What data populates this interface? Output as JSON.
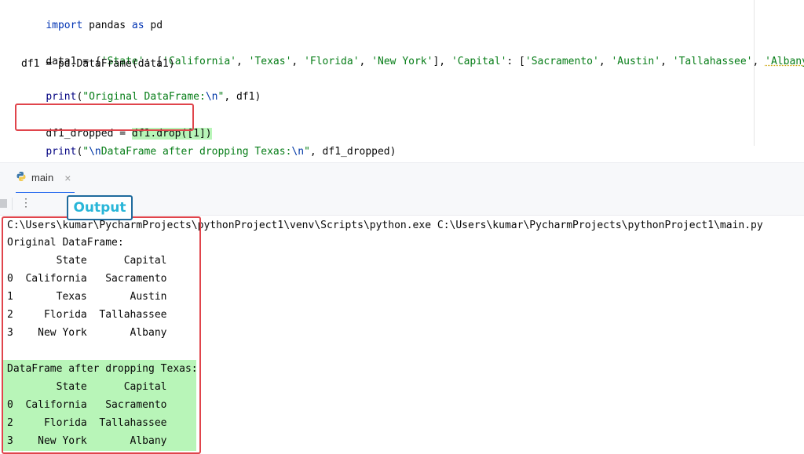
{
  "editor": {
    "line1": {
      "kw1": "import",
      "mod": " pandas ",
      "kw2": "as",
      "alias": " pd"
    },
    "line2": {
      "prefix": "data1 = {",
      "s1": "'State'",
      "p1": ": [",
      "s2": "'California'",
      "c1": ", ",
      "s3": "'Texas'",
      "c2": ", ",
      "s4": "'Florida'",
      "c3": ", ",
      "s5": "'New York'",
      "p2": "], ",
      "s6": "'Capital'",
      "p3": ": [",
      "s7": "'Sacramento'",
      "c4": ", ",
      "s8": "'Austin'",
      "c5": ", ",
      "s9": "'Tallahassee'",
      "c6": ", ",
      "s10": "'Albany'",
      "suffix": "]}"
    },
    "line3": "df1 = pd.DataFrame(data1)",
    "line4": {
      "fn": "print",
      "open": "(",
      "str_a": "\"Original DataFrame:",
      "esc": "\\n",
      "str_b": "\"",
      "rest": ", df1)"
    },
    "line5": {
      "lhs": "df1_dropped = ",
      "call": "df1.drop([1])"
    },
    "line6": {
      "fn": "print",
      "open": "(",
      "str_a": "\"",
      "esc1": "\\n",
      "str_b": "DataFrame after dropping Texas:",
      "esc2": "\\n",
      "str_c": "\"",
      "rest": ", df1_dropped)"
    }
  },
  "run_tab": {
    "label": "main",
    "close": "×"
  },
  "toolbar": {
    "more": "⋮"
  },
  "badge": {
    "label": "Output"
  },
  "console": {
    "command": "C:\\Users\\kumar\\PycharmProjects\\pythonProject1\\venv\\Scripts\\python.exe C:\\Users\\kumar\\PycharmProjects\\pythonProject1\\main.py",
    "original_title": "Original DataFrame:",
    "original_header": "        State      Capital",
    "original_rows": [
      "0  California   Sacramento",
      "1       Texas       Austin",
      "2     Florida  Tallahassee",
      "3    New York       Albany"
    ],
    "dropped_title": "DataFrame after dropping Texas:",
    "dropped_header": "        State      Capital",
    "dropped_rows": [
      "0  California   Sacramento",
      "2     Florida  Tallahassee",
      "3    New York       Albany"
    ]
  },
  "colors": {
    "highlight_red": "#e0444b",
    "highlight_green": "#b8f5b8",
    "badge_text": "#29b6d8",
    "badge_border": "#1f6b9d"
  }
}
